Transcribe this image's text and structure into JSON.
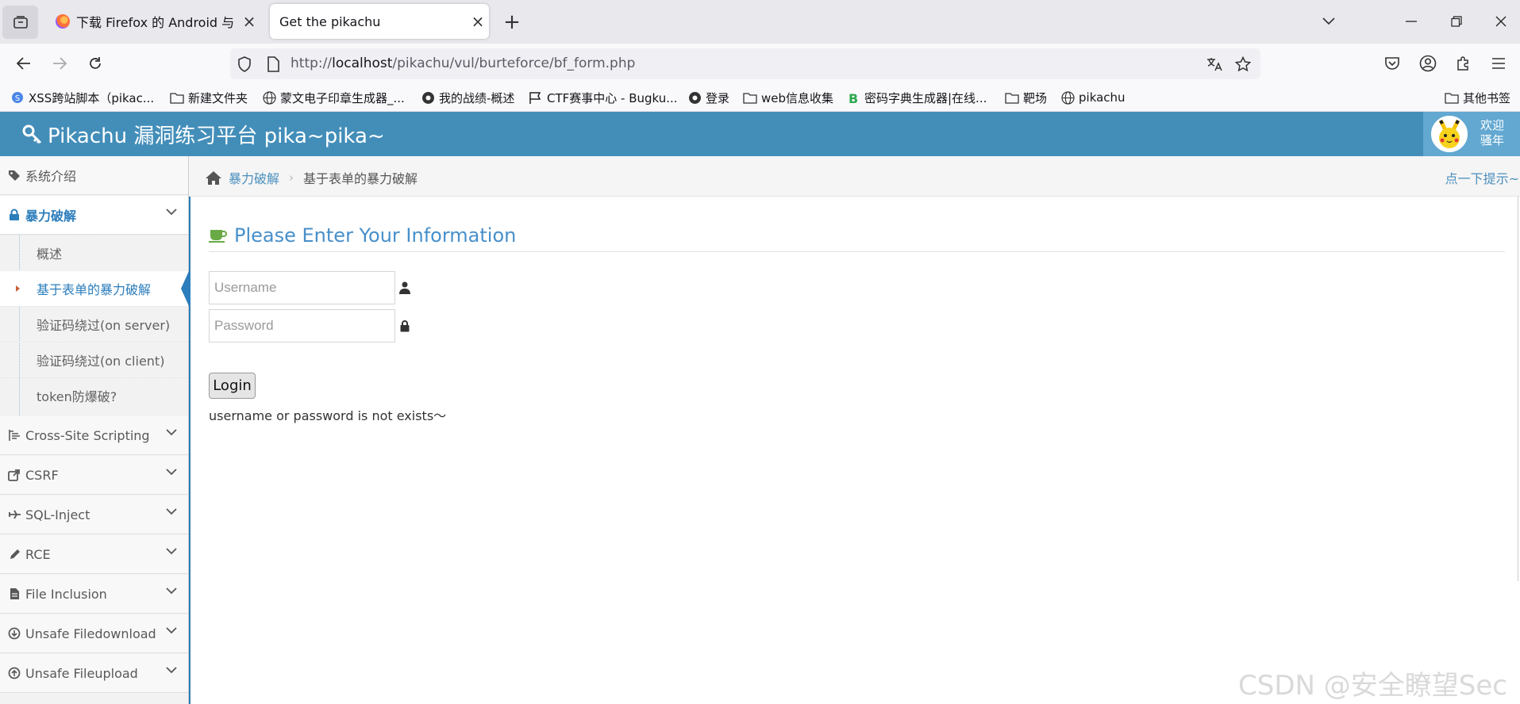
{
  "browser": {
    "tabs": [
      {
        "title": "下载 Firefox 的 Android 与 iOS 版",
        "active": false
      },
      {
        "title": "Get the pikachu",
        "active": true
      }
    ],
    "url": {
      "prefix": "http://",
      "host": "localhost",
      "path": "/pikachu/vul/burteforce/bf_form.php"
    },
    "bookmarks": [
      {
        "label": "XSS跨站脚本（pikac...",
        "icon": "site-icon"
      },
      {
        "label": "新建文件夹",
        "icon": "folder-icon"
      },
      {
        "label": "蒙文电子印章生成器_...",
        "icon": "globe-icon"
      },
      {
        "label": "我的战绩-概述",
        "icon": "site-icon"
      },
      {
        "label": "CTF赛事中心 - Bugku...",
        "icon": "flag-icon"
      },
      {
        "label": "登录",
        "icon": "site-icon"
      },
      {
        "label": "web信息收集",
        "icon": "folder-icon"
      },
      {
        "label": "密码字典生成器|在线...",
        "icon": "b-icon"
      },
      {
        "label": "靶场",
        "icon": "folder-icon"
      },
      {
        "label": "pikachu",
        "icon": "globe-icon"
      }
    ],
    "other_bookmarks": "其他书签"
  },
  "site": {
    "title": "Pikachu 漏洞练习平台 pika~pika~",
    "welcome_line1": "欢迎",
    "welcome_line2": "骚年"
  },
  "sidebar": {
    "items": [
      {
        "label": "系统介绍",
        "icon": "tags-icon"
      },
      {
        "label": "暴力破解",
        "icon": "lock-icon",
        "open": true
      },
      {
        "label": "Cross-Site Scripting",
        "icon": "xss-icon"
      },
      {
        "label": "CSRF",
        "icon": "share-icon"
      },
      {
        "label": "SQL-Inject",
        "icon": "plane-icon"
      },
      {
        "label": "RCE",
        "icon": "pencil-icon"
      },
      {
        "label": "File Inclusion",
        "icon": "file-icon"
      },
      {
        "label": "Unsafe Filedownload",
        "icon": "download-icon"
      },
      {
        "label": "Unsafe Fileupload",
        "icon": "upload-icon"
      }
    ],
    "submenu": [
      {
        "label": "概述"
      },
      {
        "label": "基于表单的暴力破解",
        "active": true
      },
      {
        "label": "验证码绕过(on server)"
      },
      {
        "label": "验证码绕过(on client)"
      },
      {
        "label": "token防爆破?"
      }
    ]
  },
  "breadcrumb": {
    "parent": "暴力破解",
    "current": "基于表单的暴力破解",
    "hint": "点一下提示~"
  },
  "form": {
    "heading": "Please Enter Your Information",
    "username_placeholder": "Username",
    "password_placeholder": "Password",
    "login_label": "Login",
    "message": "username or password is not exists～"
  },
  "watermark": "CSDN @安全瞭望Sec",
  "colors": {
    "header": "#438eb9",
    "accent": "#2b7dbc",
    "heading": "#478fca"
  }
}
